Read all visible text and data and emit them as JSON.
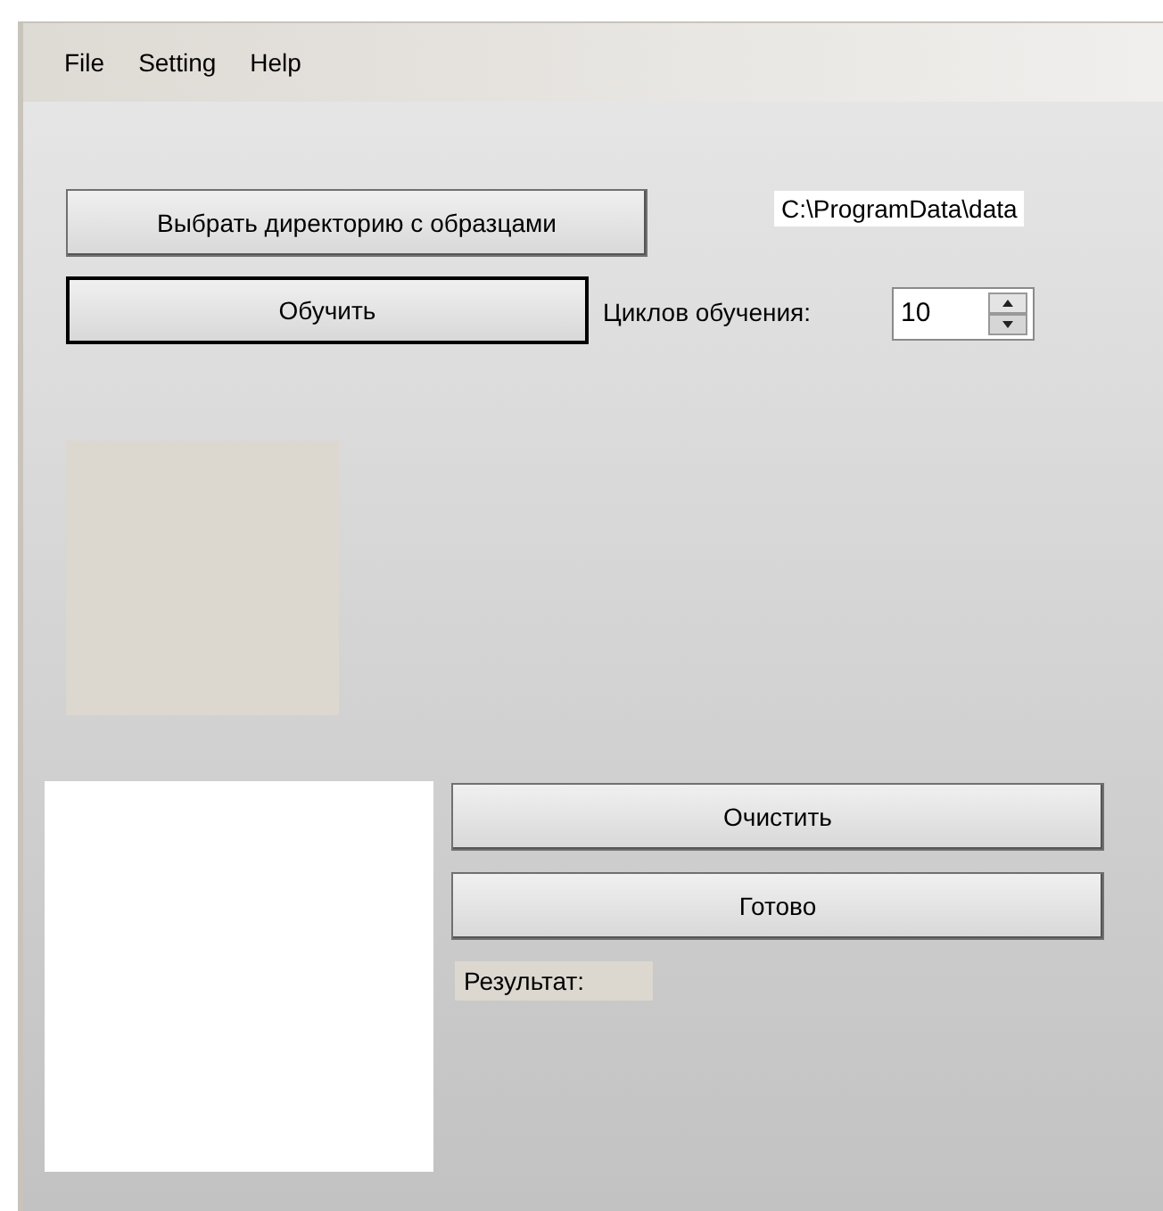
{
  "menu": [
    {
      "label": "File"
    },
    {
      "label": "Setting"
    },
    {
      "label": "Help"
    }
  ],
  "select_dir_button": {
    "label": "Выбрать директорию с образцами",
    "focused": false
  },
  "path_label": "C:\\ProgramData\\data",
  "train_button": {
    "label": "Обучить",
    "focused": true
  },
  "cycles": {
    "label": "Циклов обучения:",
    "value": "10"
  },
  "clear_button": {
    "label": "Очистить",
    "focused": false
  },
  "done_button": {
    "label": "Готово",
    "focused": false
  },
  "result_label": "Результат:"
}
